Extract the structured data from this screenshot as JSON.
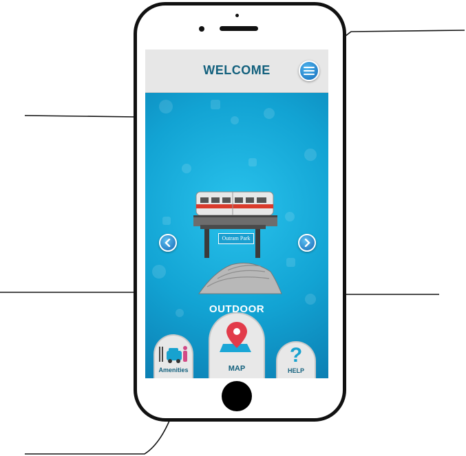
{
  "header": {
    "title": "WELCOME",
    "menu_icon": "hamburger-menu-icon"
  },
  "carousel": {
    "station_name": "Outram Park",
    "category": "OUTDOOR",
    "page_count": 2,
    "active_page": 1,
    "prev_icon": "chevron-left-icon",
    "next_icon": "chevron-right-icon"
  },
  "nav": {
    "amenities_label": "Amenities",
    "map_label": "MAP",
    "help_label": "HELP"
  },
  "colors": {
    "screen_blue": "#14a6d4",
    "header_text": "#12607d",
    "pin_red": "#e23b4a",
    "train_red": "#d93a2b"
  }
}
